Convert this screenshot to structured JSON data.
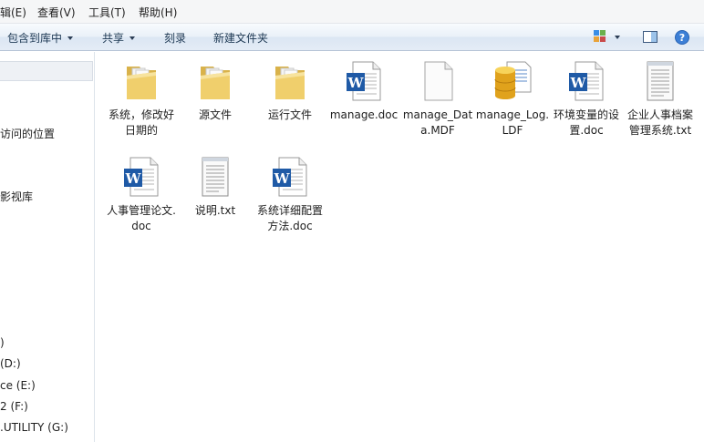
{
  "menu": {
    "edit": "编辑(E)",
    "view": "查看(V)",
    "tools": "工具(T)",
    "help": "帮助(H)"
  },
  "toolbar": {
    "include_library": "包含到库中",
    "share": "共享",
    "burn": "刻录",
    "new_folder": "新建文件夹"
  },
  "nav": {
    "recent_places": "访问的位置",
    "videos": "影视库",
    "drive_c_tail": ")",
    "drive_d": "(D:)",
    "drive_e": "ce (E:)",
    "drive_f": "2 (F:)",
    "drive_g": ".UTILITY (G:)"
  },
  "files": [
    {
      "name": "系统，修改好日期的",
      "type": "folder"
    },
    {
      "name": "源文件",
      "type": "folder"
    },
    {
      "name": "运行文件",
      "type": "folder"
    },
    {
      "name": "manage.doc",
      "type": "doc"
    },
    {
      "name": "manage_Data.MDF",
      "type": "blank"
    },
    {
      "name": "manage_Log.LDF",
      "type": "db"
    },
    {
      "name": "环境变量的设置.doc",
      "type": "doc"
    },
    {
      "name": "企业人事档案管理系统.txt",
      "type": "txt"
    },
    {
      "name": "人事管理论文.doc",
      "type": "doc"
    },
    {
      "name": "说明.txt",
      "type": "txt"
    },
    {
      "name": "系统详细配置方法.doc",
      "type": "doc"
    }
  ]
}
